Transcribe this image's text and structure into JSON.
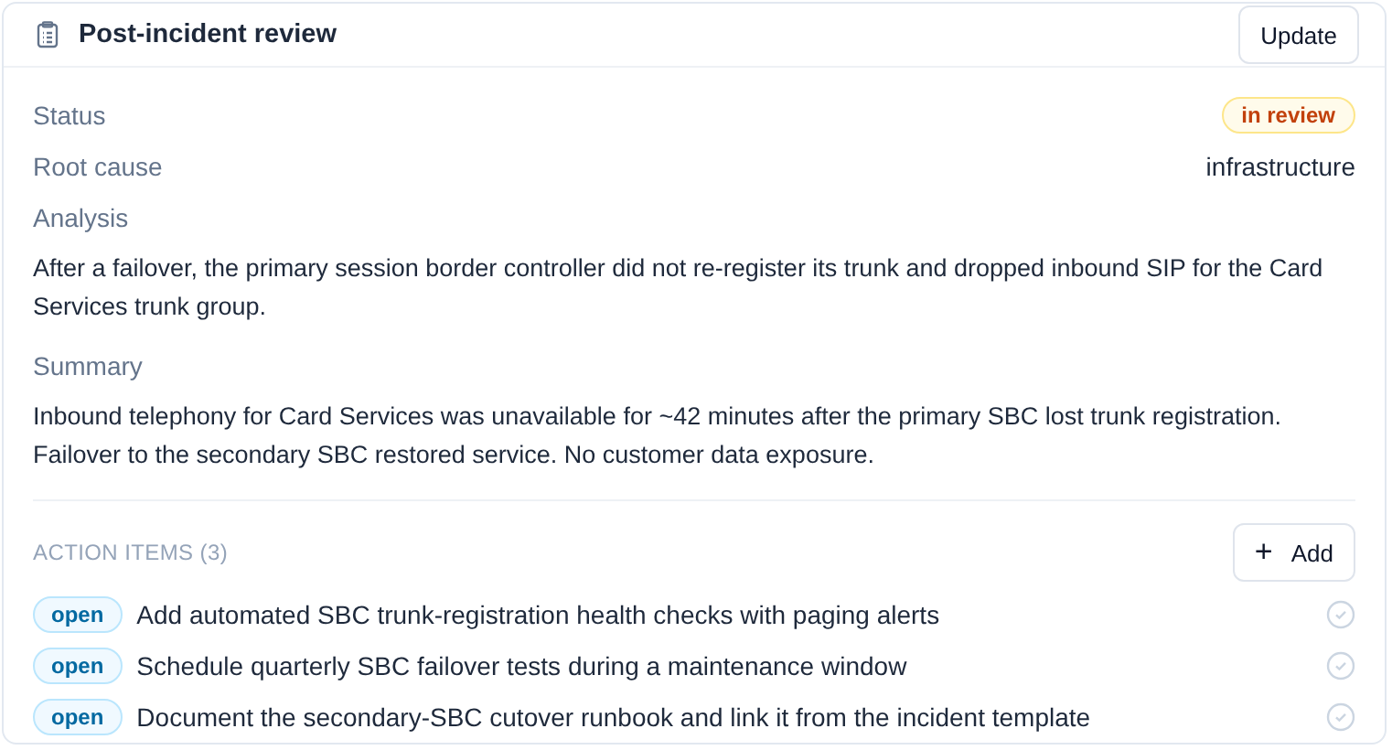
{
  "header": {
    "title": "Post-incident review",
    "button": "Update"
  },
  "fields": [
    {
      "kind": "badge",
      "label": "Status",
      "value": "in review"
    },
    {
      "kind": "inline",
      "label": "Root cause",
      "value": "infrastructure"
    },
    {
      "kind": "block",
      "label": "Analysis",
      "value": "After a failover, the primary session border controller did not re-register its trunk and dropped inbound SIP for the Card Services trunk group."
    },
    {
      "kind": "block",
      "label": "Summary",
      "value": "Inbound telephony for Card Services was unavailable for ~42 minutes after the primary SBC lost trunk registration. Failover to the secondary SBC restored service. No customer data exposure."
    }
  ],
  "action_items": {
    "heading": "ACTION ITEMS (3)",
    "add_button": {
      "icon": "+",
      "label": "Add"
    },
    "items": [
      {
        "status": "open",
        "text": "Add automated SBC trunk-registration health checks with paging alerts",
        "done": false
      },
      {
        "status": "open",
        "text": "Schedule quarterly SBC failover tests during a maintenance window",
        "done": false
      },
      {
        "status": "open",
        "text": "Document the secondary-SBC cutover runbook and link it from the incident template",
        "done": false
      }
    ]
  }
}
